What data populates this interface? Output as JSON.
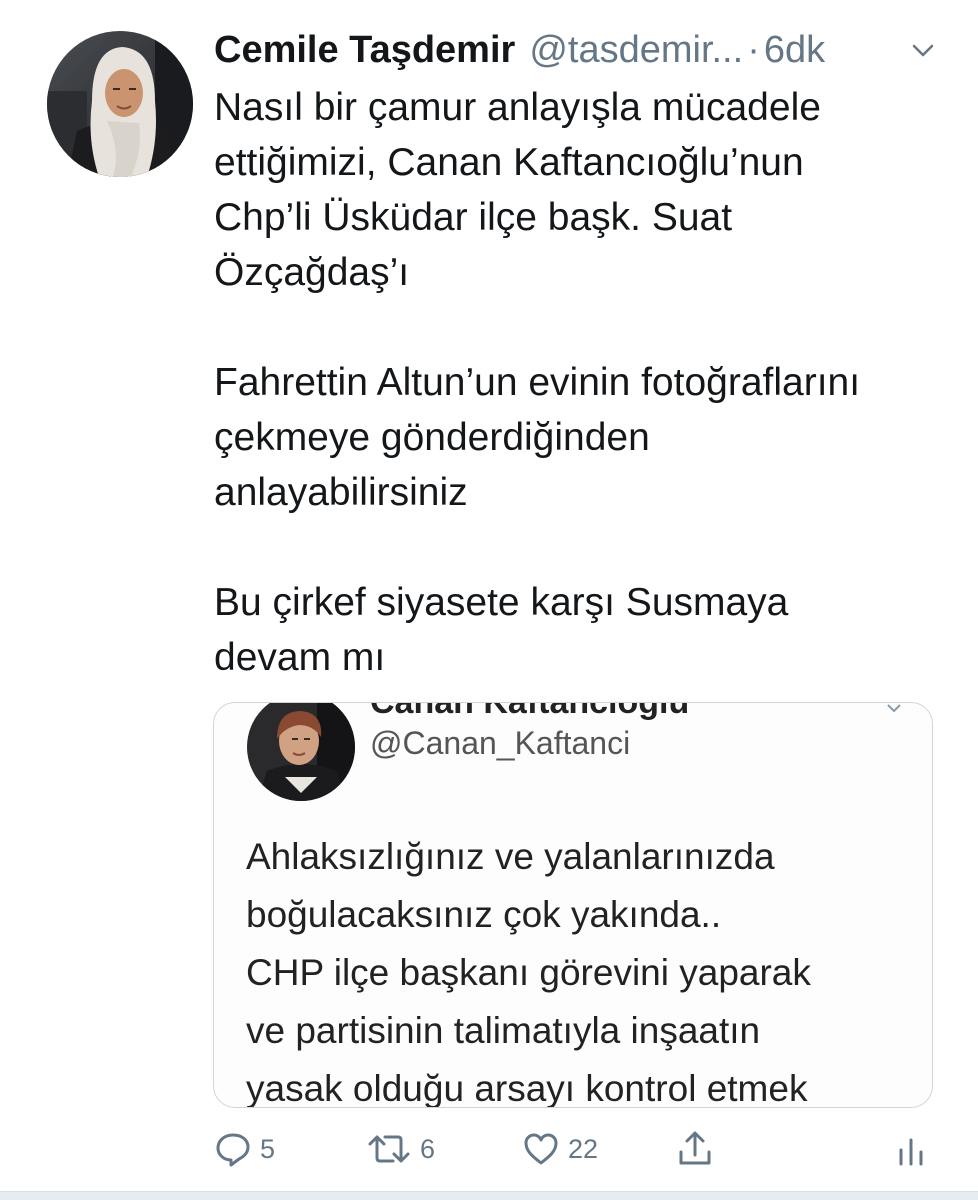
{
  "author": {
    "name": "Cemile Taşdemir",
    "handle": "@tasdemir...",
    "separator": "·",
    "time": "6dk"
  },
  "tweet": {
    "paragraphs": [
      [
        "Nasıl bir çamur anlayışla mücadele",
        "ettiğimizi, Canan Kaftancıoğlu’nun",
        "Chp’li Üsküdar ilçe başk. Suat",
        "Özçağdaş’ı"
      ],
      [
        "Fahrettin Altun’un evinin fotoğraflarını",
        "çekmeye gönderdiğinden",
        "anlayabilirsiniz"
      ],
      [
        "Bu çirkef siyasete karşı Susmaya",
        "devam mı"
      ]
    ]
  },
  "embedded": {
    "name": "Canan Kaftancıoğlu",
    "handle": "@Canan_Kaftanci",
    "lines": [
      "Ahlaksızlığınız ve yalanlarınızda",
      "boğulacaksınız çok yakında..",
      "CHP ilçe başkanı görevini yaparak",
      "ve partisinin talimatıyla  inşaatın",
      "yasak olduğu arsayı kontrol etmek"
    ]
  },
  "actions": {
    "replies": "5",
    "retweets": "6",
    "likes": "22"
  },
  "icons": {
    "reply": "reply-icon",
    "retweet": "retweet-icon",
    "like": "heart-icon",
    "share": "share-icon",
    "analytics": "analytics-icon",
    "menu": "chevron-down-icon"
  },
  "colors": {
    "text": "#14171a",
    "secondary": "#657786",
    "border": "#ccd6dd"
  }
}
